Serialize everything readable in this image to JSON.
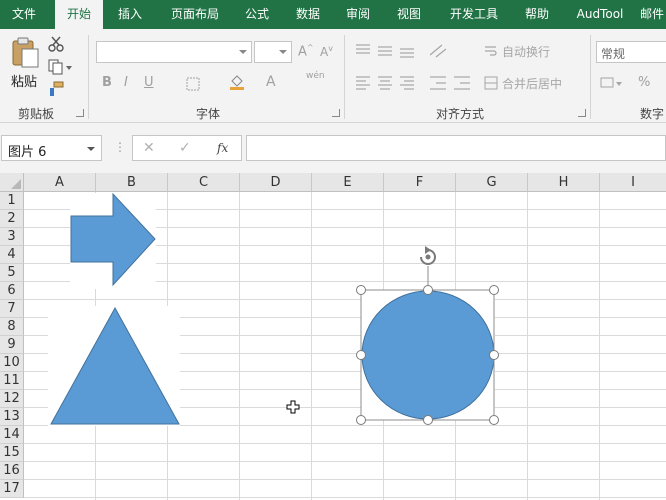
{
  "ribbon_tabs": [
    "文件",
    "开始",
    "插入",
    "页面布局",
    "公式",
    "数据",
    "审阅",
    "视图",
    "开发工具",
    "帮助",
    "AudTool",
    "邮件"
  ],
  "active_tab": "开始",
  "clipboard": {
    "paste_label": "粘贴",
    "group_label": "剪贴板"
  },
  "font": {
    "group_label": "字体",
    "bold": "B",
    "italic": "I",
    "underline": "U",
    "font_color_a": "A",
    "wen": "wén"
  },
  "alignment": {
    "group_label": "对齐方式",
    "wrap_text": "自动换行",
    "merge_center": "合并后居中"
  },
  "number": {
    "format_value": "常规",
    "group_label": "数字",
    "percent": "%"
  },
  "formula_bar": {
    "name_box": "图片 6",
    "fx": "fx",
    "cancel": "✕",
    "enter": "✓",
    "formula": ""
  },
  "columns": [
    "A",
    "B",
    "C",
    "D",
    "E",
    "F",
    "G",
    "H",
    "I"
  ],
  "rows": [
    "1",
    "2",
    "3",
    "4",
    "5",
    "6",
    "7",
    "8",
    "9",
    "10",
    "11",
    "12",
    "13",
    "14",
    "15",
    "16",
    "17"
  ],
  "colors": {
    "ribbon_green": "#217346",
    "shape_fill": "#5b9bd5",
    "shape_stroke": "#41719c"
  }
}
